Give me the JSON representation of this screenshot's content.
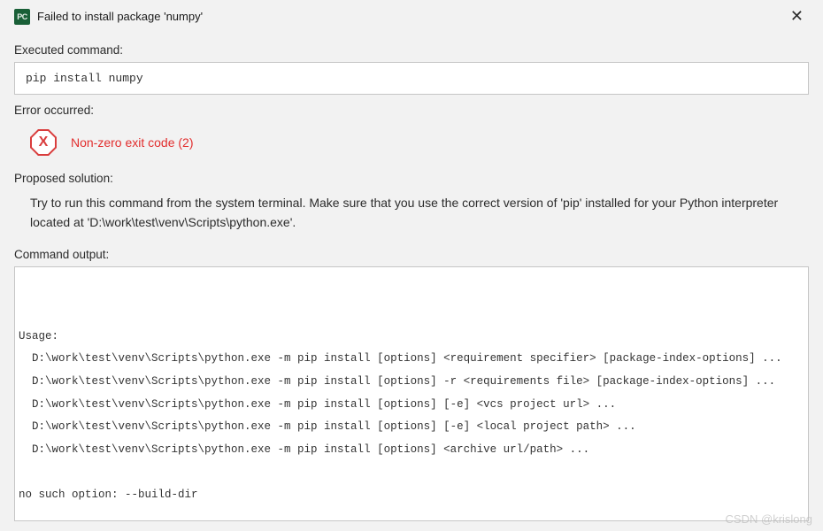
{
  "title_bar": {
    "icon_text": "PC",
    "title": "Failed to install package 'numpy'",
    "close_glyph": "✕"
  },
  "sections": {
    "executed_command_label": "Executed command:",
    "executed_command": "pip install numpy",
    "error_occurred_label": "Error occurred:",
    "error_icon_glyph": "X",
    "error_message": "Non-zero exit code (2)",
    "proposed_solution_label": "Proposed solution:",
    "proposed_solution": "Try to run this command from the system terminal. Make sure that you use the correct version of 'pip' installed for your Python interpreter located at 'D:\\work\\test\\venv\\Scripts\\python.exe'.",
    "command_output_label": "Command output:",
    "command_output": "\n\nUsage:\n  D:\\work\\test\\venv\\Scripts\\python.exe -m pip install [options] <requirement specifier> [package-index-options] ...\n  D:\\work\\test\\venv\\Scripts\\python.exe -m pip install [options] -r <requirements file> [package-index-options] ...\n  D:\\work\\test\\venv\\Scripts\\python.exe -m pip install [options] [-e] <vcs project url> ...\n  D:\\work\\test\\venv\\Scripts\\python.exe -m pip install [options] [-e] <local project path> ...\n  D:\\work\\test\\venv\\Scripts\\python.exe -m pip install [options] <archive url/path> ...\n\nno such option: --build-dir"
  },
  "watermark": "CSDN @krislong"
}
